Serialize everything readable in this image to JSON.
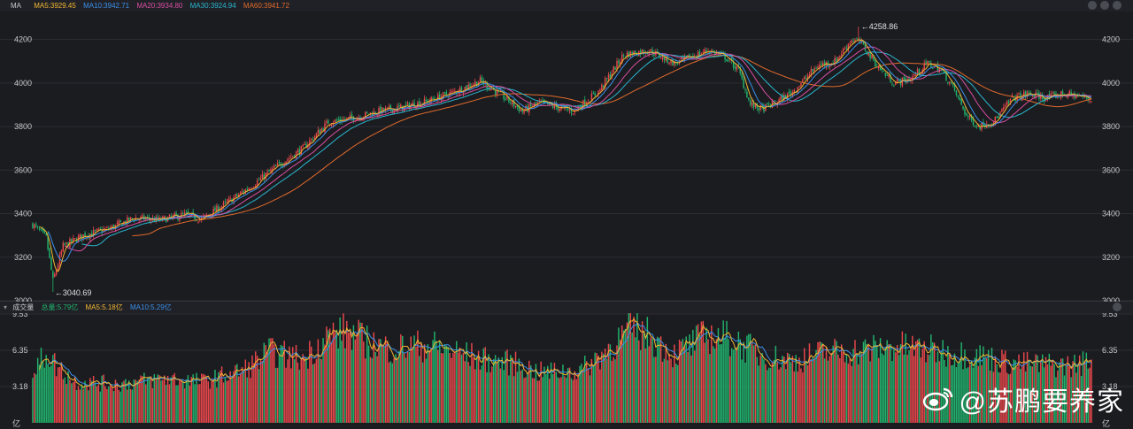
{
  "header": {
    "indicator": "MA",
    "ma5": "MA5:3929.45",
    "ma10": "MA10:3942.71",
    "ma20": "MA20:3934.80",
    "ma30": "MA30:3924.94",
    "ma60": "MA60:3941.72"
  },
  "volume_header": {
    "title": "成交量",
    "total": "总量:5.79亿",
    "ma5": "MA5:5.18亿",
    "ma10": "MA10:5.29亿"
  },
  "watermark": {
    "text": "@苏鹏要养家"
  },
  "colors": {
    "up": "#e8474b",
    "down": "#21b36d",
    "ma5": "#f0b534",
    "ma10": "#3b8fe8",
    "ma20": "#d84ea1",
    "ma30": "#28b5cd",
    "ma60": "#e06a2c",
    "grid": "#2c2d33",
    "bg": "#1b1c20"
  },
  "chart_data": [
    {
      "type": "candlestick",
      "ylim": [
        3000,
        4300
      ],
      "yticks": [
        "3000",
        "3200",
        "3400",
        "3600",
        "3800",
        "4000",
        "4200"
      ],
      "annotations": {
        "high": "4258.86",
        "low": "3040.69"
      },
      "series_legend": [
        "MA5",
        "MA10",
        "MA20",
        "MA30",
        "MA60"
      ],
      "close_keypoints": [
        [
          0,
          3350
        ],
        [
          8,
          3290
        ],
        [
          12,
          3090
        ],
        [
          18,
          3250
        ],
        [
          30,
          3300
        ],
        [
          45,
          3330
        ],
        [
          60,
          3380
        ],
        [
          75,
          3370
        ],
        [
          90,
          3395
        ],
        [
          100,
          3375
        ],
        [
          115,
          3450
        ],
        [
          130,
          3530
        ],
        [
          145,
          3620
        ],
        [
          160,
          3700
        ],
        [
          175,
          3820
        ],
        [
          190,
          3840
        ],
        [
          205,
          3870
        ],
        [
          220,
          3890
        ],
        [
          235,
          3920
        ],
        [
          250,
          3960
        ],
        [
          265,
          4010
        ],
        [
          280,
          3930
        ],
        [
          290,
          3870
        ],
        [
          300,
          3910
        ],
        [
          310,
          3890
        ],
        [
          320,
          3870
        ],
        [
          335,
          3960
        ],
        [
          350,
          4130
        ],
        [
          365,
          4150
        ],
        [
          380,
          4090
        ],
        [
          390,
          4120
        ],
        [
          400,
          4150
        ],
        [
          410,
          4120
        ],
        [
          418,
          4060
        ],
        [
          425,
          3900
        ],
        [
          432,
          3880
        ],
        [
          440,
          3910
        ],
        [
          450,
          3960
        ],
        [
          465,
          4080
        ],
        [
          475,
          4100
        ],
        [
          485,
          4200
        ],
        [
          490,
          4190
        ],
        [
          500,
          4080
        ],
        [
          510,
          4000
        ],
        [
          520,
          4020
        ],
        [
          530,
          4090
        ],
        [
          538,
          4060
        ],
        [
          545,
          3980
        ],
        [
          553,
          3850
        ],
        [
          560,
          3800
        ],
        [
          570,
          3830
        ],
        [
          580,
          3930
        ],
        [
          590,
          3950
        ],
        [
          600,
          3930
        ],
        [
          610,
          3950
        ],
        [
          620,
          3940
        ],
        [
          628,
          3920
        ]
      ],
      "candle_count": 628
    },
    {
      "type": "bar",
      "ylim": [
        0,
        9.53
      ],
      "yticks": [
        "3.18",
        "6.35",
        "9.53"
      ],
      "unit": "亿",
      "volume_keypoints": [
        [
          0,
          4.2
        ],
        [
          8,
          6.2
        ],
        [
          14,
          5.0
        ],
        [
          25,
          3.6
        ],
        [
          50,
          3.4
        ],
        [
          80,
          3.9
        ],
        [
          100,
          3.6
        ],
        [
          125,
          4.6
        ],
        [
          140,
          6.2
        ],
        [
          160,
          5.6
        ],
        [
          175,
          7.6
        ],
        [
          185,
          8.0
        ],
        [
          195,
          7.3
        ],
        [
          210,
          6.5
        ],
        [
          235,
          6.8
        ],
        [
          265,
          5.6
        ],
        [
          285,
          5.2
        ],
        [
          300,
          4.4
        ],
        [
          325,
          4.6
        ],
        [
          345,
          7.0
        ],
        [
          355,
          8.3
        ],
        [
          365,
          7.6
        ],
        [
          380,
          6.0
        ],
        [
          400,
          7.7
        ],
        [
          415,
          7.3
        ],
        [
          430,
          6.0
        ],
        [
          450,
          5.4
        ],
        [
          470,
          6.2
        ],
        [
          490,
          6.3
        ],
        [
          510,
          6.7
        ],
        [
          530,
          6.4
        ],
        [
          545,
          6.1
        ],
        [
          560,
          5.9
        ],
        [
          580,
          5.2
        ],
        [
          600,
          5.1
        ],
        [
          615,
          5.0
        ],
        [
          628,
          5.5
        ]
      ]
    }
  ]
}
